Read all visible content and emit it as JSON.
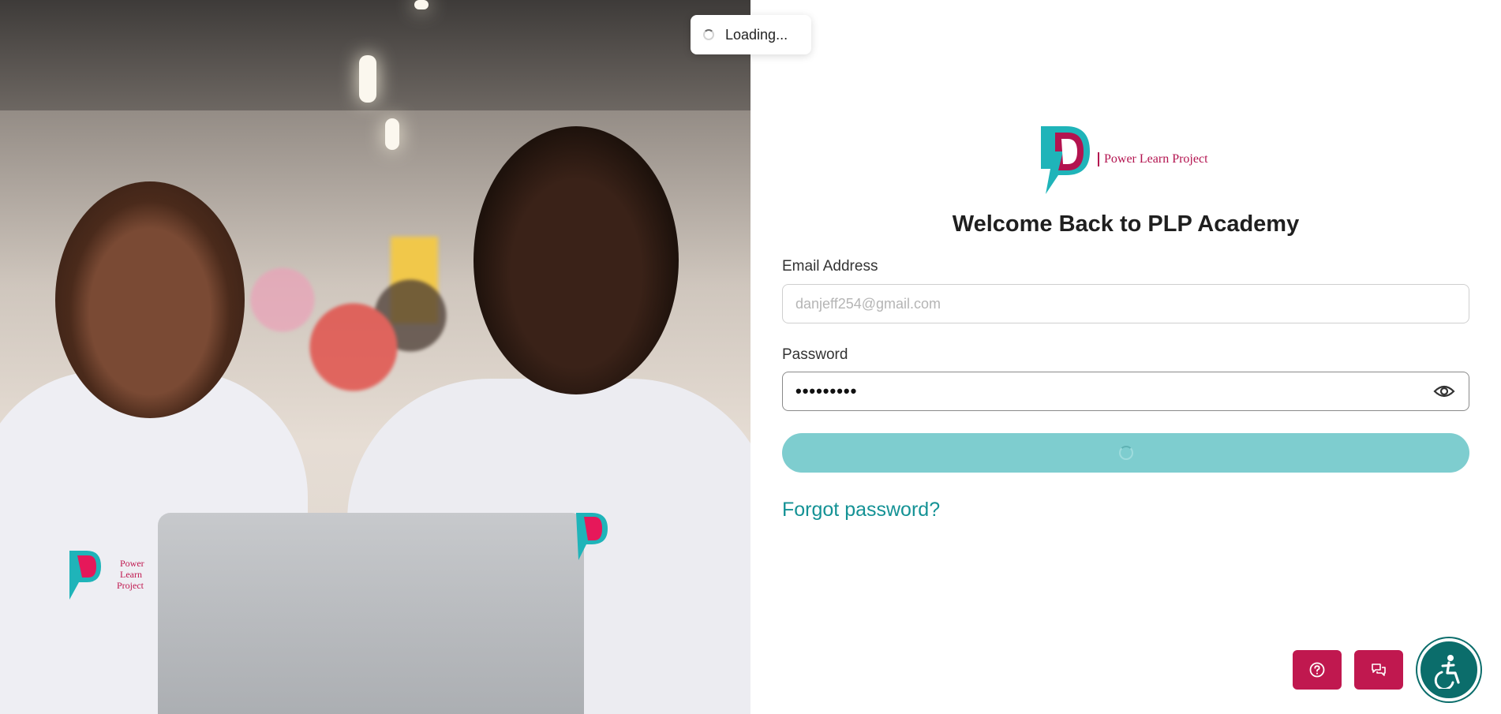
{
  "toast": {
    "text": "Loading..."
  },
  "brand": {
    "name": "Power Learn Project",
    "primary_color": "#b3134f",
    "accent_color": "#1fb4b9"
  },
  "login": {
    "title": "Welcome Back to PLP Academy",
    "email_label": "Email Address",
    "email_placeholder": "danjeff254@gmail.com",
    "email_value": "",
    "password_label": "Password",
    "password_value": "•••••••••",
    "forgot_link": "Forgot password?",
    "submit_color": "#7ecdcf"
  },
  "shirt_logo": {
    "line1": "Power",
    "line2": "Learn",
    "line3": "Project"
  },
  "floating": {
    "help_icon": "question-circle-icon",
    "chat_icon": "chat-bubbles-icon",
    "accessibility_icon": "accessibility-icon",
    "button_color": "#c0184f",
    "accessibility_color": "#0b6d6b"
  }
}
